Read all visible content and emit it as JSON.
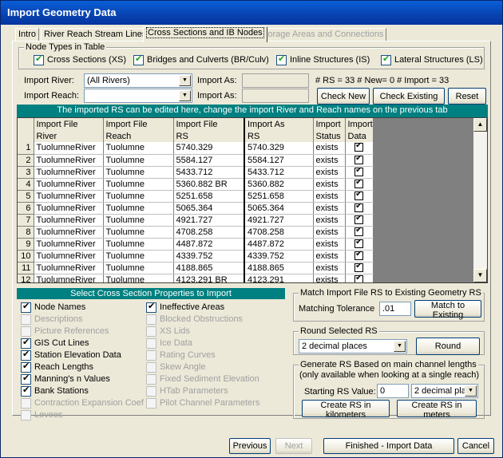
{
  "window": {
    "title": "Import Geometry Data"
  },
  "tabs": [
    {
      "label": "Intro",
      "state": "normal"
    },
    {
      "label": "River Reach Stream Lines",
      "state": "normal"
    },
    {
      "label": "Cross Sections and IB Nodes",
      "state": "active"
    },
    {
      "label": "Storage Areas and Connections",
      "state": "disabled"
    }
  ],
  "node_types": {
    "legend": "Node Types in Table",
    "xs": "Cross Sections (XS)",
    "br": "Bridges and Culverts (BR/Culv)",
    "is": "Inline Structures (IS)",
    "ls": "Lateral Structures (LS)"
  },
  "import": {
    "river_label": "Import River:",
    "river_value": "(All Rivers)",
    "reach_label": "Import Reach:",
    "reach_value": "",
    "as_label_1": "Import As:",
    "as_label_2": "Import As:",
    "counts": "# RS = 33  # New= 0  # Import = 33",
    "check_new": "Check New",
    "check_existing": "Check Existing",
    "reset": "Reset"
  },
  "banner": "The imported RS can be edited here, change the import River and Reach names on the previous tab",
  "table": {
    "headers_top": [
      "Import File",
      "Import File",
      "Import File",
      "Import As",
      "Import",
      "Import"
    ],
    "headers_bottom": [
      "River",
      "Reach",
      "RS",
      "RS",
      "Status",
      "Data"
    ],
    "rows": [
      {
        "n": "1",
        "river": "TuolumneRiver",
        "reach": "Tuolumne",
        "rs": "5740.329",
        "as": "5740.329",
        "status": "exists"
      },
      {
        "n": "2",
        "river": "TuolumneRiver",
        "reach": "Tuolumne",
        "rs": "5584.127",
        "as": "5584.127",
        "status": "exists"
      },
      {
        "n": "3",
        "river": "TuolumneRiver",
        "reach": "Tuolumne",
        "rs": "5433.712",
        "as": "5433.712",
        "status": "exists"
      },
      {
        "n": "4",
        "river": "TuolumneRiver",
        "reach": "Tuolumne",
        "rs": "5360.882 BR",
        "as": "5360.882",
        "status": "exists"
      },
      {
        "n": "5",
        "river": "TuolumneRiver",
        "reach": "Tuolumne",
        "rs": "5251.658",
        "as": "5251.658",
        "status": "exists"
      },
      {
        "n": "6",
        "river": "TuolumneRiver",
        "reach": "Tuolumne",
        "rs": "5065.364",
        "as": "5065.364",
        "status": "exists"
      },
      {
        "n": "7",
        "river": "TuolumneRiver",
        "reach": "Tuolumne",
        "rs": "4921.727",
        "as": "4921.727",
        "status": "exists"
      },
      {
        "n": "8",
        "river": "TuolumneRiver",
        "reach": "Tuolumne",
        "rs": "4708.258",
        "as": "4708.258",
        "status": "exists"
      },
      {
        "n": "9",
        "river": "TuolumneRiver",
        "reach": "Tuolumne",
        "rs": "4487.872",
        "as": "4487.872",
        "status": "exists"
      },
      {
        "n": "10",
        "river": "TuolumneRiver",
        "reach": "Tuolumne",
        "rs": "4339.752",
        "as": "4339.752",
        "status": "exists"
      },
      {
        "n": "11",
        "river": "TuolumneRiver",
        "reach": "Tuolumne",
        "rs": "4188.865",
        "as": "4188.865",
        "status": "exists"
      },
      {
        "n": "12",
        "river": "TuolumneRiver",
        "reach": "Tuolumne",
        "rs": "4123.291 BR",
        "as": "4123.291",
        "status": "exists"
      }
    ]
  },
  "xs_props": {
    "banner": "Select Cross Section Properties to Import",
    "left": [
      {
        "label": "Node Names",
        "checked": true,
        "enabled": true
      },
      {
        "label": "Descriptions",
        "checked": false,
        "enabled": false
      },
      {
        "label": "Picture References",
        "checked": false,
        "enabled": false
      },
      {
        "label": "GIS Cut Lines",
        "checked": true,
        "enabled": true
      },
      {
        "label": "Station Elevation Data",
        "checked": true,
        "enabled": true
      },
      {
        "label": "Reach Lengths",
        "checked": true,
        "enabled": true
      },
      {
        "label": "Manning's n Values",
        "checked": true,
        "enabled": true
      },
      {
        "label": "Bank Stations",
        "checked": true,
        "enabled": true
      },
      {
        "label": "Contraction Expansion Coef",
        "checked": false,
        "enabled": false
      },
      {
        "label": "Levees",
        "checked": false,
        "enabled": false
      }
    ],
    "right": [
      {
        "label": "Ineffective Areas",
        "checked": true,
        "enabled": true
      },
      {
        "label": "Blocked Obstructions",
        "checked": false,
        "enabled": false
      },
      {
        "label": "XS Lids",
        "checked": false,
        "enabled": false
      },
      {
        "label": "Ice Data",
        "checked": false,
        "enabled": false
      },
      {
        "label": "Rating Curves",
        "checked": false,
        "enabled": false
      },
      {
        "label": "Skew Angle",
        "checked": false,
        "enabled": false
      },
      {
        "label": "Fixed Sediment Elevation",
        "checked": false,
        "enabled": false
      },
      {
        "label": "HTab Parameters",
        "checked": false,
        "enabled": false
      },
      {
        "label": "Pilot Channel Parameters",
        "checked": false,
        "enabled": false
      }
    ]
  },
  "match": {
    "legend": "Match Import File RS to Existing Geometry RS",
    "tolerance_label": "Matching Tolerance",
    "tolerance_value": ".01",
    "button": "Match to Existing"
  },
  "round": {
    "legend": "Round Selected RS",
    "value": "2 decimal places",
    "button": "Round"
  },
  "generate": {
    "legend": "Generate RS Based on main channel lengths",
    "note": "(only available when looking at a single reach)",
    "start_label": "Starting RS  Value:",
    "start_value": "0",
    "decimals": "2 decimal plac",
    "km_button": "Create RS in kilometers",
    "m_button": "Create RS in meters"
  },
  "footer": {
    "previous": "Previous",
    "next": "Next",
    "finish": "Finished - Import Data",
    "cancel": "Cancel"
  }
}
